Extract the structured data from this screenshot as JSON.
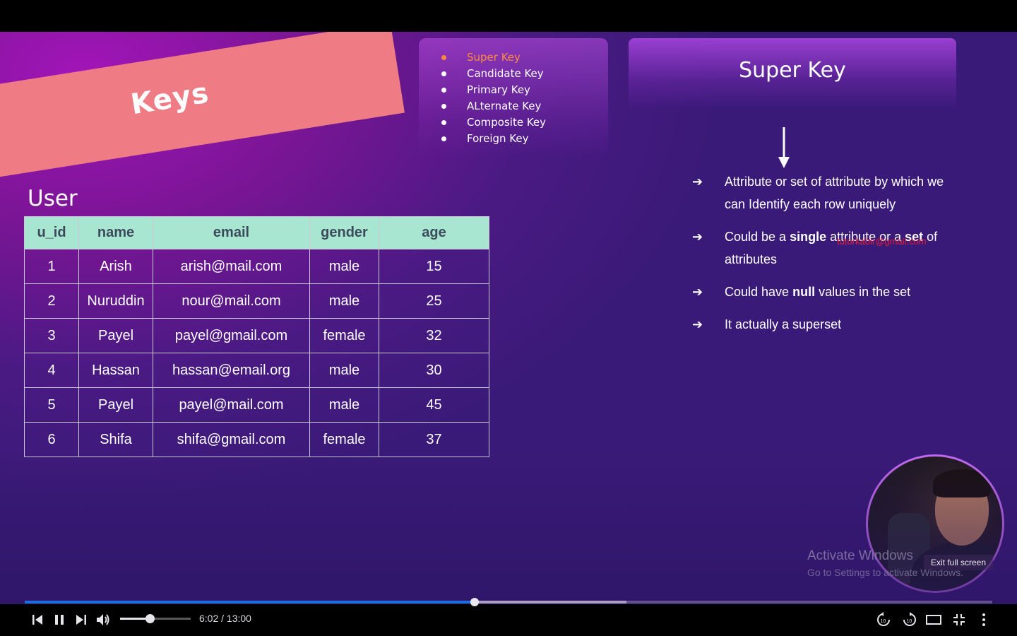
{
  "slide": {
    "banner_title": "Keys",
    "key_list": [
      {
        "label": "Super Key",
        "active": true
      },
      {
        "label": "Candidate Key",
        "active": false
      },
      {
        "label": "Primary Key",
        "active": false
      },
      {
        "label": "ALternate Key",
        "active": false
      },
      {
        "label": "Composite Key",
        "active": false
      },
      {
        "label": "Foreign Key",
        "active": false
      }
    ],
    "heading": "Super Key",
    "bullets": [
      {
        "pre": "Attribute or set of attribute by which we can Identify each row uniquely",
        "b1": "",
        "mid": "",
        "b2": "",
        "post": ""
      },
      {
        "pre": "Could be a ",
        "b1": "single",
        "mid": " attribute or a ",
        "b2": "set",
        "post": " of attributes"
      },
      {
        "pre": "Could have ",
        "b1": "null",
        "mid": " values in the set",
        "b2": "",
        "post": ""
      },
      {
        "pre": "It actually a superset",
        "b1": "",
        "mid": "",
        "b2": "",
        "post": ""
      }
    ],
    "bullet_arrow": "➔",
    "watermark_email": "tutorkabir@gmail.com",
    "table": {
      "title": "User",
      "columns": [
        "u_id",
        "name",
        "email",
        "gender",
        "age"
      ],
      "rows": [
        [
          "1",
          "Arish",
          "arish@mail.com",
          "male",
          "15"
        ],
        [
          "2",
          "Nuruddin",
          "nour@mail.com",
          "male",
          "25"
        ],
        [
          "3",
          "Payel",
          "payel@gmail.com",
          "female",
          "32"
        ],
        [
          "4",
          "Hassan",
          "hassan@email.org",
          "male",
          "30"
        ],
        [
          "5",
          "Payel",
          "payel@mail.com",
          "male",
          "45"
        ],
        [
          "6",
          "Shifa",
          "shifa@gmail.com",
          "female",
          "37"
        ]
      ]
    }
  },
  "overlay": {
    "activate_title": "Activate Windows",
    "activate_sub": "Go to Settings to activate Windows.",
    "exit_fullscreen": "Exit full screen"
  },
  "player": {
    "time": "6:02 / 13:00",
    "progress_played": 0.465,
    "progress_buffered": 0.622,
    "volume": 0.42,
    "icons": [
      "previous-icon",
      "pause-icon",
      "next-icon",
      "volume-icon",
      "rewind-10-icon",
      "forward-10-icon",
      "theater-mode-icon",
      "exit-fullscreen-icon",
      "more-options-icon"
    ],
    "accent_color": "#1f6fe0"
  }
}
